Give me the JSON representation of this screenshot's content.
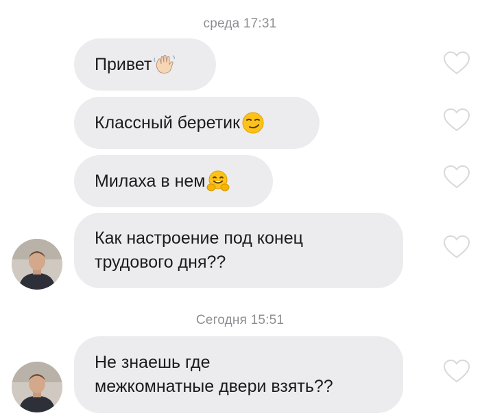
{
  "chat": {
    "date_label_1": "среда 17:31",
    "date_label_2": "Сегодня 15:51",
    "messages": [
      {
        "text": "Привет",
        "emoji": "waving-hand-icon"
      },
      {
        "text": "Классный беретик",
        "emoji": "smirking-face-icon"
      },
      {
        "text": "Милаха в нем",
        "emoji": "hugging-face-icon"
      },
      {
        "text": "Как настроение под конец\nтрудового дня??"
      },
      {
        "text": "Не знаешь где\nмежкомнатные двери взять??"
      }
    ]
  },
  "colors": {
    "bubble": "#ececee",
    "timestamp": "#8e8e93",
    "heart_outline": "#d8d8dc"
  }
}
